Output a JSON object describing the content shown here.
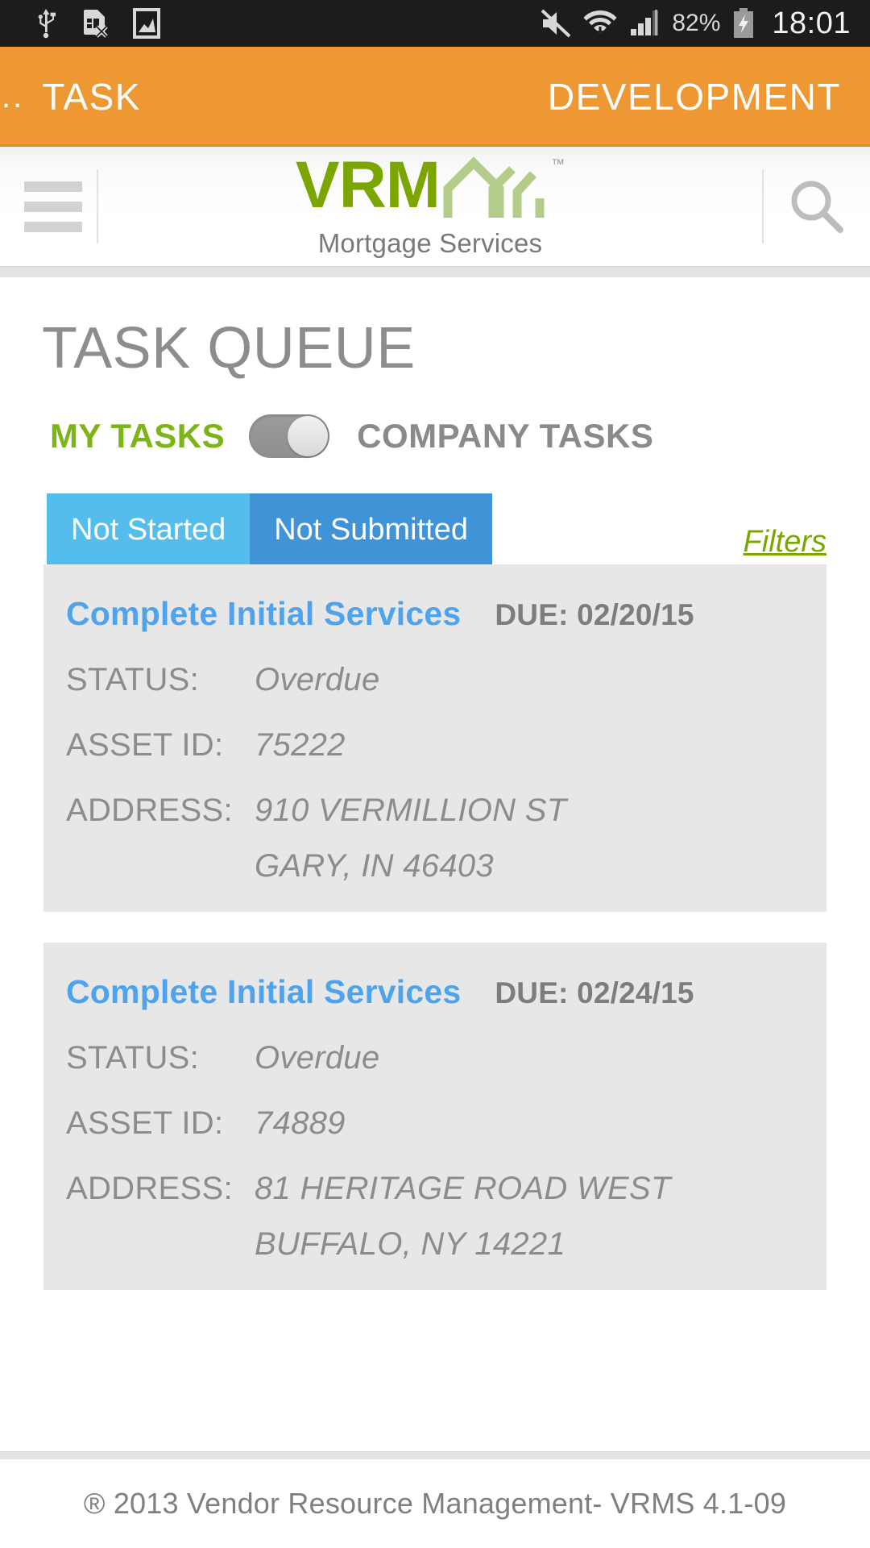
{
  "statusbar": {
    "icons": [
      "usb-icon",
      "sim-card-error-icon",
      "screenshot-image-icon",
      "mute-icon",
      "wifi-icon",
      "signal-icon"
    ],
    "battery_percent": "82%",
    "battery_icon": "battery-charging-icon",
    "clock": "18:01"
  },
  "appbar": {
    "overflow_dots": "..",
    "title": "TASK",
    "environment": "DEVELOPMENT",
    "accent_color": "#ee9833"
  },
  "header": {
    "menu_icon": "hamburger-menu-icon",
    "logo_text": "VRM",
    "logo_trademark": "™",
    "logo_subtitle": "Mortgage Services",
    "logo_color": "#7ba600",
    "house_color": "#b4cc8a",
    "search_icon": "search-icon"
  },
  "page": {
    "title": "TASK QUEUE"
  },
  "toggle": {
    "left_label": "MY TASKS",
    "right_label": "COMPANY TASKS",
    "state": "left",
    "active_color": "#7cb518",
    "inactive_color": "#8a8a8a"
  },
  "tabs": {
    "items": [
      {
        "label": "Not Started",
        "color": "#55bdeb",
        "selected": true
      },
      {
        "label": "Not Submitted",
        "color": "#3f93d6",
        "selected": false
      }
    ],
    "filters_label": "Filters"
  },
  "labels": {
    "status": "STATUS:",
    "asset_id": "ASSET ID:",
    "address": "ADDRESS:"
  },
  "tasks": [
    {
      "title": "Complete Initial Services",
      "due": "DUE: 02/20/15",
      "status": "Overdue",
      "asset_id": "75222",
      "address_line1": "910 VERMILLION ST",
      "address_line2": "GARY, IN 46403"
    },
    {
      "title": "Complete Initial Services",
      "due": "DUE: 02/24/15",
      "status": "Overdue",
      "asset_id": "74889",
      "address_line1": "81 HERITAGE ROAD WEST",
      "address_line2": "BUFFALO, NY 14221"
    }
  ],
  "footer": {
    "text": "® 2013 Vendor Resource Management- VRMS 4.1-09"
  }
}
